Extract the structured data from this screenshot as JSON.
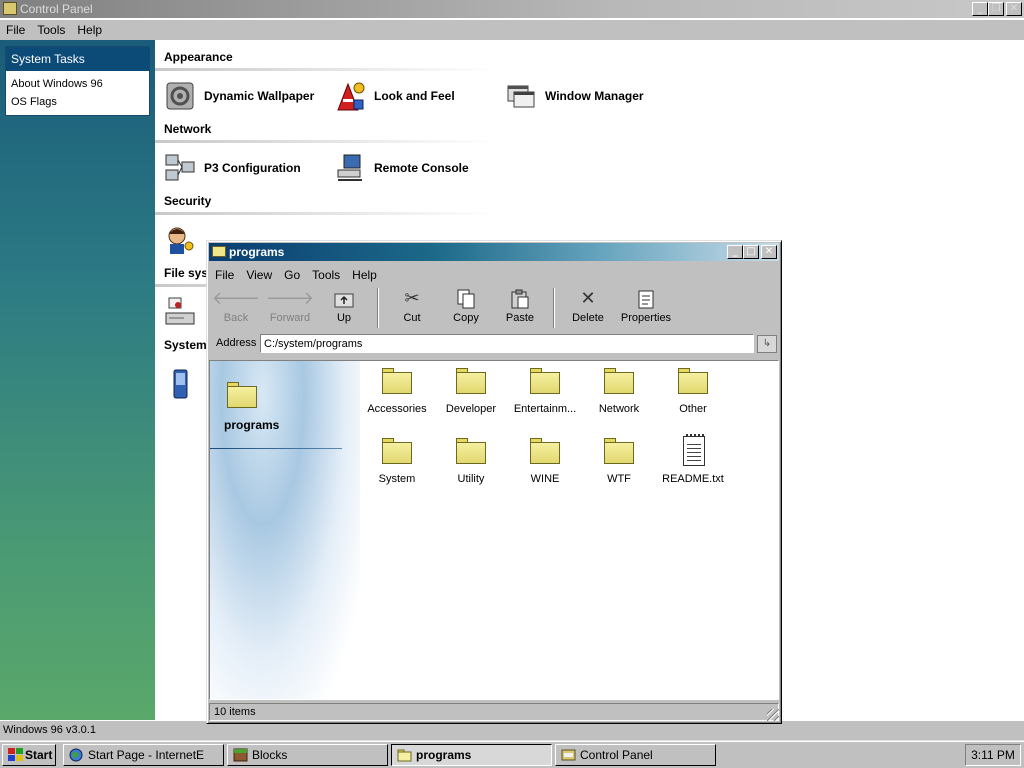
{
  "control_panel": {
    "title": "Control Panel",
    "menu": [
      "File",
      "Tools",
      "Help"
    ],
    "system_tasks": {
      "header": "System Tasks",
      "items": [
        "About Windows 96",
        "OS Flags"
      ]
    },
    "categories": {
      "appearance": "Appearance",
      "network": "Network",
      "security": "Security",
      "file_systems": "File sys",
      "system": "System"
    },
    "applets": {
      "dynamic_wallpaper": "Dynamic Wallpaper",
      "look_and_feel": "Look and Feel",
      "window_manager": "Window Manager",
      "p3_configuration": "P3 Configuration",
      "remote_console": "Remote Console"
    },
    "status": "Windows 96 v3.0.1"
  },
  "explorer": {
    "title": "programs",
    "menu": [
      "File",
      "View",
      "Go",
      "Tools",
      "Help"
    ],
    "toolbar": {
      "back": "Back",
      "forward": "Forward",
      "up": "Up",
      "cut": "Cut",
      "copy": "Copy",
      "paste": "Paste",
      "delete": "Delete",
      "properties": "Properties"
    },
    "address_label": "Address",
    "address_value": "C:/system/programs",
    "watermark_label": "programs",
    "items": [
      {
        "label": "Accessories",
        "type": "folder"
      },
      {
        "label": "Developer",
        "type": "folder"
      },
      {
        "label": "Entertainm...",
        "type": "folder"
      },
      {
        "label": "Network",
        "type": "folder"
      },
      {
        "label": "Other",
        "type": "folder"
      },
      {
        "label": "System",
        "type": "folder"
      },
      {
        "label": "Utility",
        "type": "folder"
      },
      {
        "label": "WINE",
        "type": "folder"
      },
      {
        "label": "WTF",
        "type": "folder"
      },
      {
        "label": "README.txt",
        "type": "text-file"
      }
    ],
    "status": "10 items"
  },
  "taskbar": {
    "start": "Start",
    "tasks": [
      {
        "label": "Start Page - InternetE",
        "active": false
      },
      {
        "label": "Blocks",
        "active": false
      },
      {
        "label": "programs",
        "active": true
      },
      {
        "label": "Control Panel",
        "active": false
      }
    ],
    "clock": "3:11 PM"
  },
  "colors": {
    "explorer_title_start": "#0a3d70",
    "sidebar_top": "#1a5c7a",
    "sidebar_bottom": "#5aa86a",
    "tasks_header": "#0c4a78",
    "folder_yellow": "#f6f0a0"
  }
}
